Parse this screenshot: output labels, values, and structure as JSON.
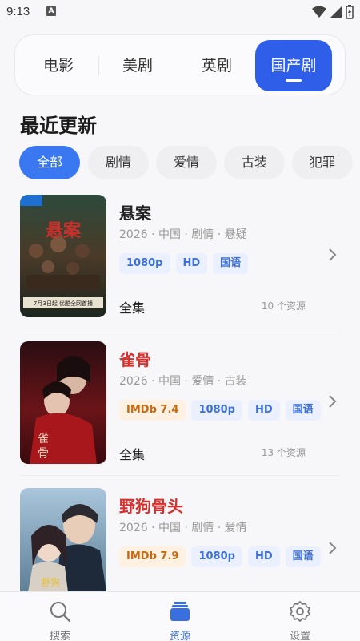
{
  "status_bar": {
    "time": "9:13",
    "notif_letter": "A"
  },
  "top_tabs": [
    {
      "label": "电影"
    },
    {
      "label": "美剧"
    },
    {
      "label": "英剧"
    },
    {
      "label": "国产剧"
    }
  ],
  "section": {
    "title": "最近更新"
  },
  "chips": [
    {
      "label": "全部"
    },
    {
      "label": "剧情"
    },
    {
      "label": "爱情"
    },
    {
      "label": "古装"
    },
    {
      "label": "犯罪"
    }
  ],
  "items": [
    {
      "title": "悬案",
      "title_color": "#222222",
      "meta": "2026 · 中国 · 剧情 · 悬疑",
      "tags": [
        "1080p",
        "HD",
        "国语"
      ],
      "status": "全集",
      "count": "10 个资源",
      "poster_text": "7月3日起 优酷全网首播"
    },
    {
      "title": "雀骨",
      "title_color": "#d8302d",
      "meta": "2026 · 中国 · 爱情 · 古装",
      "imdb": "IMDb 7.4",
      "tags": [
        "1080p",
        "HD",
        "国语"
      ],
      "status": "全集",
      "count": "13 个资源"
    },
    {
      "title": "野狗骨头",
      "title_color": "#d8302d",
      "meta": "2026 · 中国 · 剧情 · 爱情",
      "imdb": "IMDb 7.9",
      "tags": [
        "1080p",
        "HD",
        "国语"
      ]
    }
  ],
  "bottom_nav": [
    {
      "label": "搜索",
      "icon": "search-icon"
    },
    {
      "label": "资源",
      "icon": "stack-icon"
    },
    {
      "label": "设置",
      "icon": "gear-icon"
    }
  ],
  "colors": {
    "accent": "#2f5ee8",
    "chip_active": "#3a78f2",
    "title_red": "#d8302d"
  }
}
